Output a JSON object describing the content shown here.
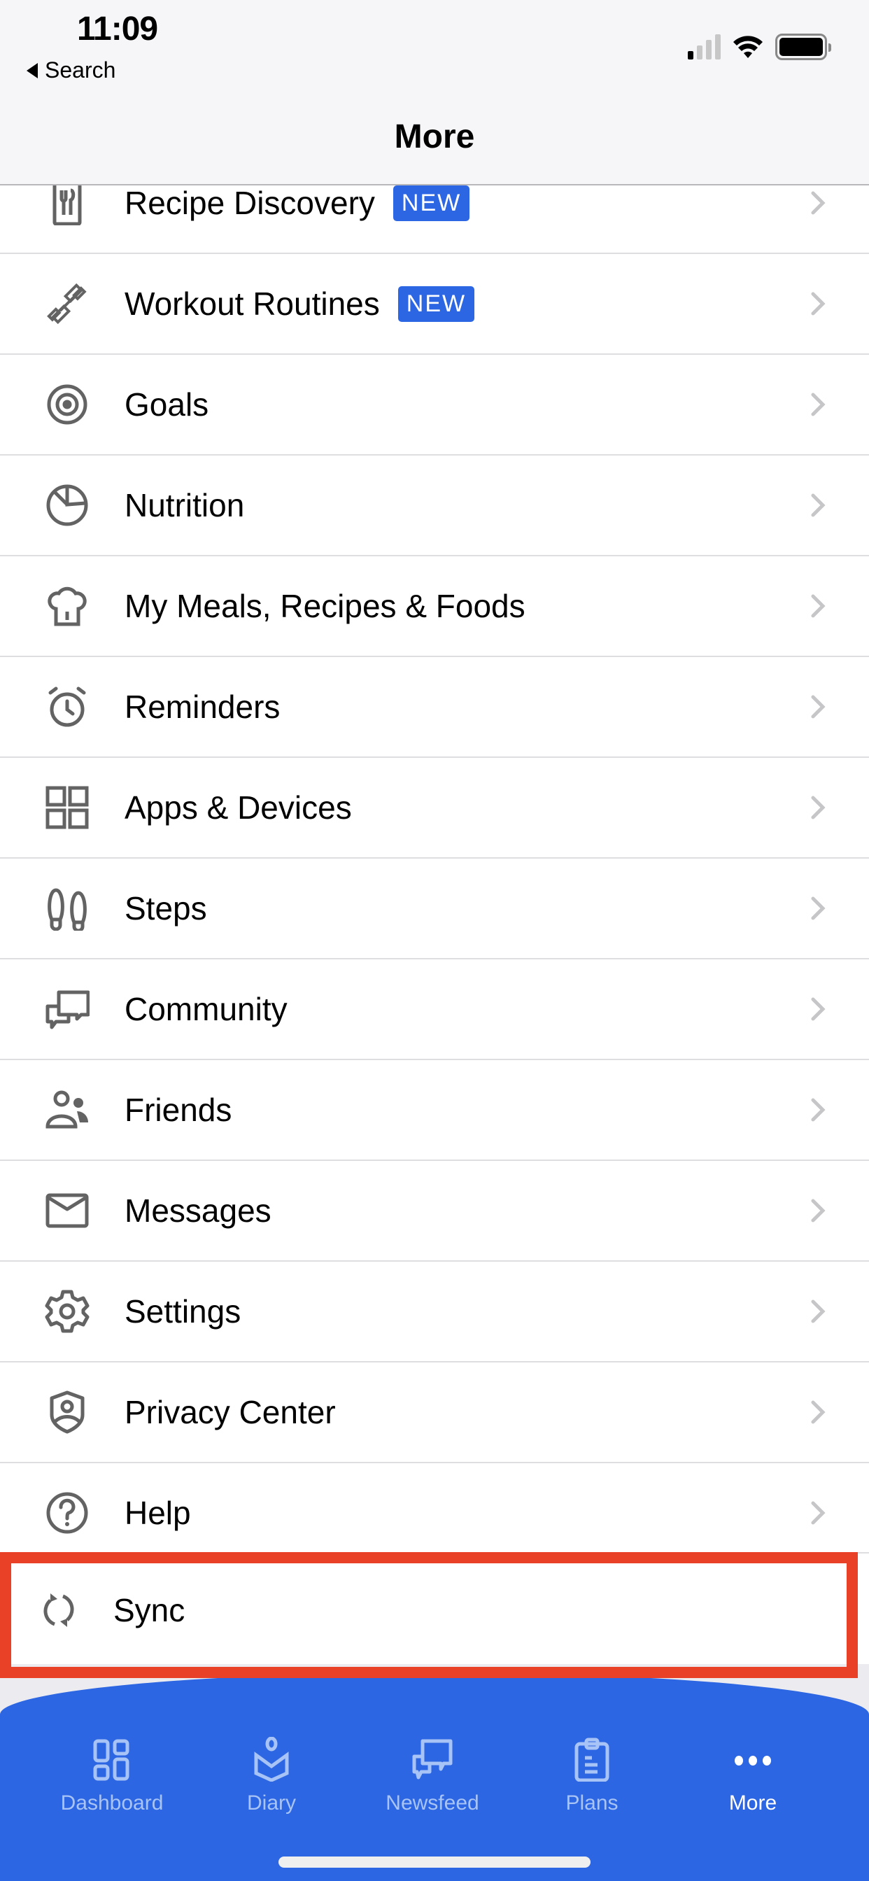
{
  "status_bar": {
    "time": "11:09",
    "back_label": "Search"
  },
  "header": {
    "title": "More"
  },
  "menu": {
    "items": [
      {
        "label": "Recipe Discovery",
        "icon": "recipe-icon",
        "badge": "NEW"
      },
      {
        "label": "Workout Routines",
        "icon": "dumbbell-icon",
        "badge": "NEW"
      },
      {
        "label": "Goals",
        "icon": "target-icon",
        "badge": null
      },
      {
        "label": "Nutrition",
        "icon": "pie-chart-icon",
        "badge": null
      },
      {
        "label": "My Meals, Recipes & Foods",
        "icon": "chef-hat-icon",
        "badge": null
      },
      {
        "label": "Reminders",
        "icon": "alarm-clock-icon",
        "badge": null
      },
      {
        "label": "Apps & Devices",
        "icon": "grid-icon",
        "badge": null
      },
      {
        "label": "Steps",
        "icon": "footprints-icon",
        "badge": null
      },
      {
        "label": "Community",
        "icon": "chat-bubbles-icon",
        "badge": null
      },
      {
        "label": "Friends",
        "icon": "friends-icon",
        "badge": null
      },
      {
        "label": "Messages",
        "icon": "envelope-icon",
        "badge": null
      },
      {
        "label": "Settings",
        "icon": "gear-icon",
        "badge": null
      },
      {
        "label": "Privacy Center",
        "icon": "shield-user-icon",
        "badge": null
      },
      {
        "label": "Help",
        "icon": "question-circle-icon",
        "badge": null
      }
    ],
    "sync": {
      "label": "Sync",
      "icon": "sync-icon"
    }
  },
  "tabbar": {
    "tabs": [
      {
        "label": "Dashboard",
        "icon": "dashboard-icon",
        "active": false
      },
      {
        "label": "Diary",
        "icon": "diary-icon",
        "active": false
      },
      {
        "label": "Newsfeed",
        "icon": "newsfeed-icon",
        "active": false
      },
      {
        "label": "Plans",
        "icon": "clipboard-icon",
        "active": false
      },
      {
        "label": "More",
        "icon": "more-dots-icon",
        "active": true
      }
    ]
  },
  "colors": {
    "accent": "#2c66e3",
    "highlight": "#e94128",
    "icon_gray": "#636363",
    "chevron": "#c6c6c8"
  }
}
